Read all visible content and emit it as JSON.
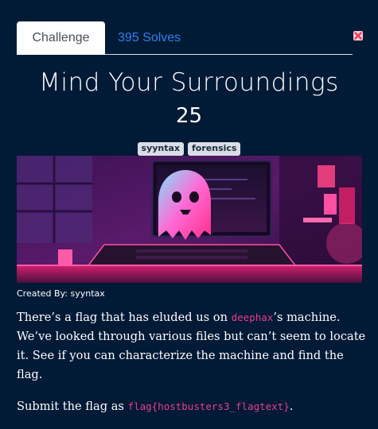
{
  "tabs": {
    "challenge_label": "Challenge",
    "solves_label": "395 Solves"
  },
  "close_icon": "close-x-icon",
  "challenge": {
    "title": "Mind Your Surroundings",
    "points": "25",
    "tags": [
      "syyntax",
      "forensics"
    ],
    "author_text": "Created By: syyntax",
    "description": {
      "part1": "There’s a flag that has eluded us on ",
      "machine": "deephax",
      "part2": "’s machine. We’ve looked through various files but can’t seem to locate it. See if you can characterize the machine and find the flag."
    },
    "submit": {
      "prefix": "Submit the flag as ",
      "flag_format": "flag{hostbusters3_flagtext}",
      "suffix": "."
    }
  },
  "colors": {
    "background": "#011a36",
    "tab_link": "#2f80ed",
    "code": "#e83e8c",
    "tag_bg": "#d9dee6",
    "close_icon": "#e83e5a"
  }
}
